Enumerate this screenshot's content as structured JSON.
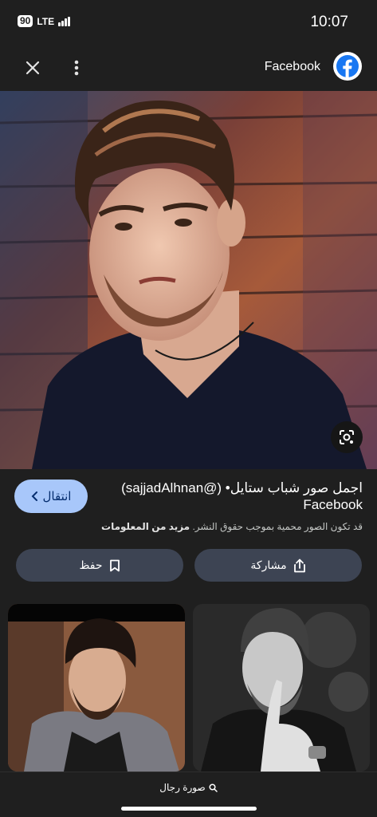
{
  "status_bar": {
    "battery": "90",
    "network": "LTE",
    "time": "10:07"
  },
  "header": {
    "source": "Facebook",
    "close_icon": "close-icon",
    "more_icon": "more-vert-icon",
    "logo_icon": "facebook-logo"
  },
  "result": {
    "visit_label": "انتقال",
    "title_line1": "اجمل صور شباب ستايل• (@sajjadAlhnan)",
    "title_line2": "Facebook",
    "copyright_text": "قد تكون الصور محمية بموجب حقوق النشر.",
    "more_info_label": "مزيد من المعلومات"
  },
  "actions": {
    "share_label": "مشاركة",
    "save_label": "حفظ"
  },
  "bottom": {
    "search_label": "صورة رجال"
  },
  "colors": {
    "background": "#1f1f1f",
    "visit_button": "#a8c7fa",
    "action_button": "#3d4453",
    "facebook_blue": "#1877f2"
  }
}
